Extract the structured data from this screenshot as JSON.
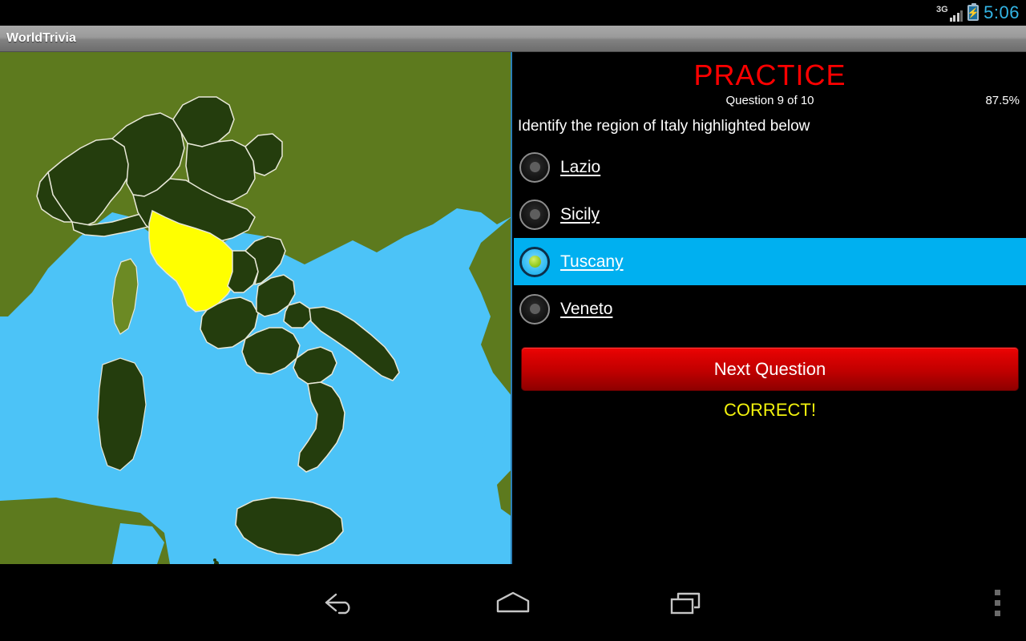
{
  "status_bar": {
    "network_label": "3G",
    "time": "5:06",
    "battery_icon": "battery-charging-icon",
    "signal_icon": "signal-bars-icon",
    "clock_color": "#33b5e5"
  },
  "title_bar": {
    "app_title": "WorldTrivia"
  },
  "map": {
    "name": "italy-regions-map",
    "highlighted_region": "Tuscany",
    "colors": {
      "sea": "#4cc3f7",
      "land_other": "#5d7a1e",
      "region_fill": "#243d0d",
      "region_border": "#e8e8d8",
      "highlight": "#ffff00"
    }
  },
  "quiz": {
    "mode_title": "PRACTICE",
    "mode_color": "#ff0000",
    "question_counter": "Question 9 of 10",
    "score": "87.5%",
    "question": "Identify the region of Italy highlighted below",
    "options": [
      {
        "label": "Lazio",
        "selected": false
      },
      {
        "label": "Sicily",
        "selected": false
      },
      {
        "label": "Tuscany",
        "selected": true
      },
      {
        "label": "Veneto",
        "selected": false
      }
    ],
    "next_button_label": "Next Question",
    "verdict": "CORRECT!",
    "verdict_color": "#f2f20d",
    "selected_row_color": "#00b0f0"
  },
  "nav_bar": {
    "back_label": "back-icon",
    "home_label": "home-icon",
    "recents_label": "recents-icon",
    "menu_label": "overflow-menu-icon"
  }
}
